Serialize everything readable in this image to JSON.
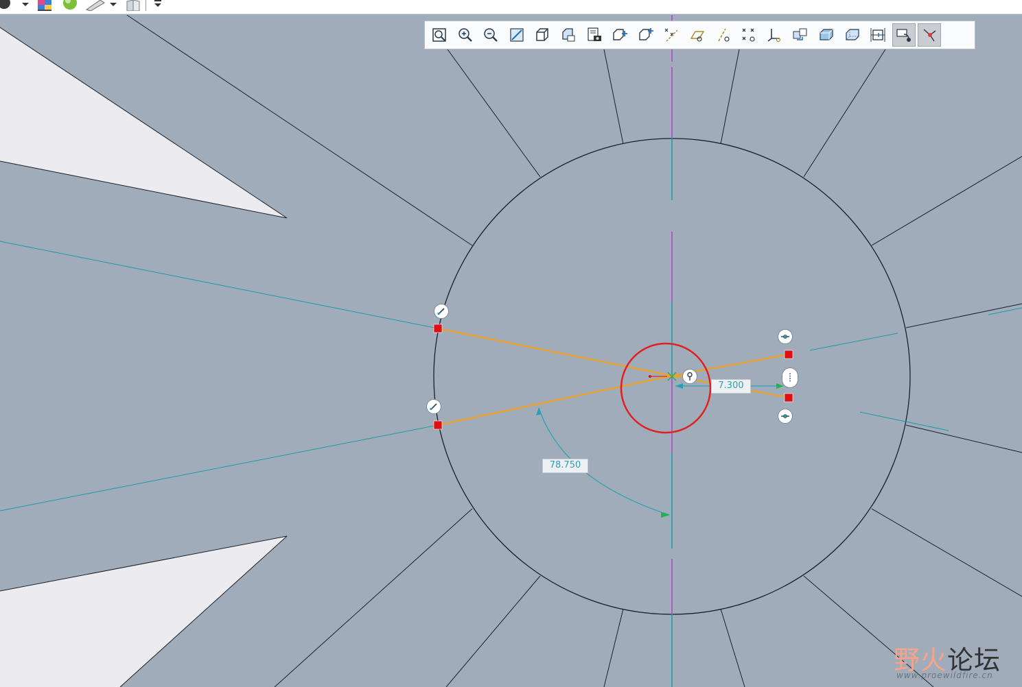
{
  "app": {
    "top_toolbar_icons": [
      "appearance-sphere-icon",
      "dropdown-arrow-icon",
      "color-palette-icon",
      "render-sphere-icon",
      "measure-ruler-icon",
      "dropdown-arrow-icon",
      "book-icon",
      "dropdown-arrow-icon"
    ]
  },
  "view_toolbar": {
    "buttons": [
      {
        "name": "refit-icon",
        "active": false
      },
      {
        "name": "zoom-in-icon",
        "active": false
      },
      {
        "name": "zoom-out-icon",
        "active": false
      },
      {
        "name": "repaint-icon",
        "active": false
      },
      {
        "name": "display-style-icon",
        "active": false
      },
      {
        "name": "saved-orientations-icon",
        "active": false
      },
      {
        "name": "view-manager-icon",
        "active": false
      },
      {
        "name": "perspective-icon",
        "active": false
      },
      {
        "name": "spin-center-icon",
        "active": false
      },
      {
        "name": "datum-display-icon",
        "active": false
      },
      {
        "name": "plane-display-icon",
        "active": false
      },
      {
        "name": "axis-display-icon",
        "active": false
      },
      {
        "name": "point-display-icon",
        "active": false
      },
      {
        "name": "csys-display-icon",
        "active": false
      },
      {
        "name": "annotation-display-icon",
        "active": false
      },
      {
        "name": "shaded-view-icon",
        "active": false
      },
      {
        "name": "hidden-line-icon",
        "active": false
      },
      {
        "name": "dimension-display-icon",
        "active": false
      },
      {
        "name": "constraint-display-icon",
        "active": true
      },
      {
        "name": "vertex-display-icon",
        "active": true
      }
    ]
  },
  "sketch": {
    "angle_dimension": "78.750",
    "linear_dimension": "7.300",
    "colors": {
      "background": "#a1acbb",
      "geometry": "#1a1f26",
      "construction": "#1a9aa6",
      "centerline": "#b040d0",
      "selected_geometry": "#f0a020",
      "highlight_circle": "#e02020",
      "endpoint_marker": "#dd1111",
      "dimension": "#2a9fb3"
    }
  },
  "watermark": {
    "title_part_a": "野火",
    "title_part_b": "论坛",
    "url": "www.proewildfire.cn"
  }
}
